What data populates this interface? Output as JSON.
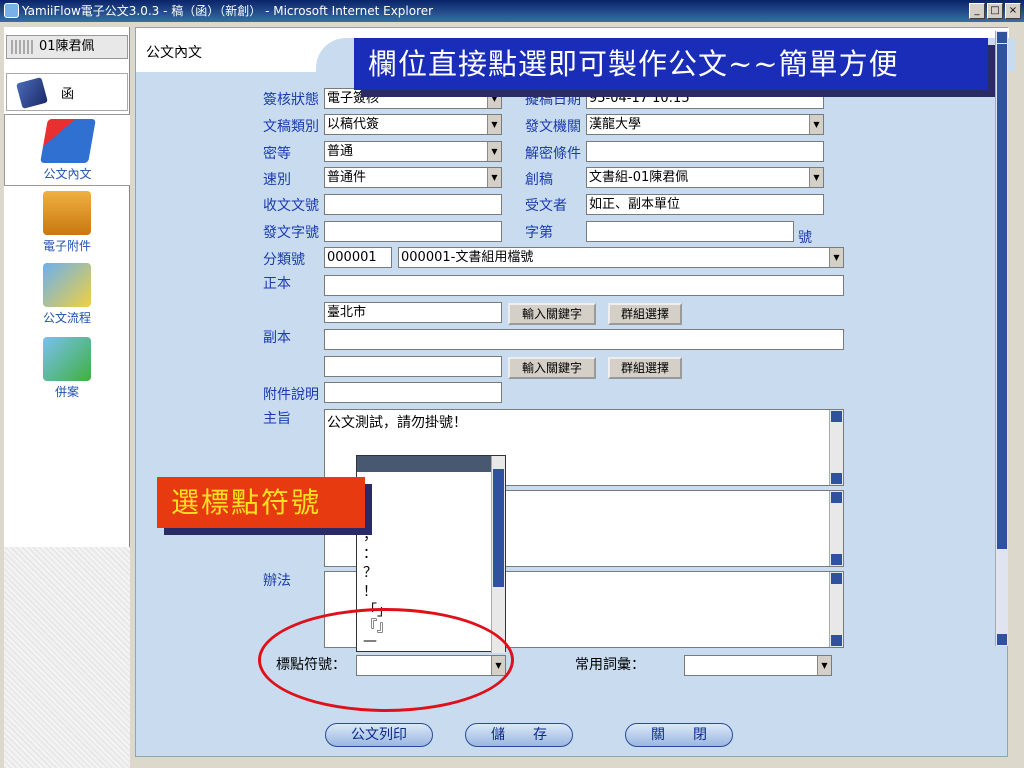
{
  "window": {
    "title": "YamiiFlow電子公文3.0.3 - 稿（函）（新創） - Microsoft Internet Explorer",
    "controls": [
      "_",
      "□",
      "×"
    ]
  },
  "sidebar": {
    "user": "01陳君佩",
    "category": "函",
    "nav": [
      {
        "label": "公文內文",
        "icon": "document-stack-icon",
        "active": true
      },
      {
        "label": "電子附件",
        "icon": "zip-folder-icon",
        "active": false
      },
      {
        "label": "公文流程",
        "icon": "workflow-arrows-icon",
        "active": false
      },
      {
        "label": "併案",
        "icon": "merge-download-icon",
        "active": false
      }
    ]
  },
  "header": {
    "title": "公文內文"
  },
  "banners": {
    "top": "欄位直接點選即可製作公文~~簡單方便",
    "callout": "選標點符號"
  },
  "form": {
    "status": {
      "label": "簽核狀態",
      "value": "電子簽核"
    },
    "draft_date": {
      "label": "擬稿日期",
      "value": "95-04-17 10:15"
    },
    "draft_type": {
      "label": "文稿類別",
      "value": "以稿代簽"
    },
    "send_org": {
      "label": "發文機關",
      "value": "漢龍大學"
    },
    "secrecy": {
      "label": "密等",
      "value": "普通"
    },
    "declassify": {
      "label": "解密條件",
      "value": ""
    },
    "speed": {
      "label": "速別",
      "value": "普通件"
    },
    "drafter": {
      "label": "創稿",
      "value": "文書組-01陳君佩"
    },
    "recv_no": {
      "label": "收文文號",
      "value": ""
    },
    "recipient": {
      "label": "受文者",
      "value": "如正、副本單位"
    },
    "send_no": {
      "label": "發文字號",
      "value": ""
    },
    "word_no": {
      "label": "字第",
      "value": "",
      "suffix": "號"
    },
    "category": {
      "label": "分類號",
      "code": "000001",
      "value": "000001-文書組用檔號"
    },
    "main_copy": {
      "label": "正本",
      "value": "",
      "keyword": "臺北市",
      "kw_button": "輸入關鍵字",
      "grp_button": "群組選擇"
    },
    "cc": {
      "label": "副本",
      "value": "",
      "keyword": "",
      "kw_button": "輸入關鍵字",
      "grp_button": "群組選擇"
    },
    "attach_note": {
      "label": "附件說明",
      "value": ""
    },
    "subject": {
      "label": "主旨",
      "value": "公文測試，請勿掛號！"
    },
    "method": {
      "label": "辦法"
    },
    "punct": {
      "label": "標點符號：",
      "value": ""
    },
    "phrases": {
      "label": "常用詞彙：",
      "value": ""
    }
  },
  "dropdown": {
    "options": [
      "；",
      "：",
      "？",
      "！",
      "「」",
      "『』",
      "—"
    ]
  },
  "buttons": {
    "print": "公文列印",
    "save": "儲　　存",
    "close": "關　　閉"
  }
}
